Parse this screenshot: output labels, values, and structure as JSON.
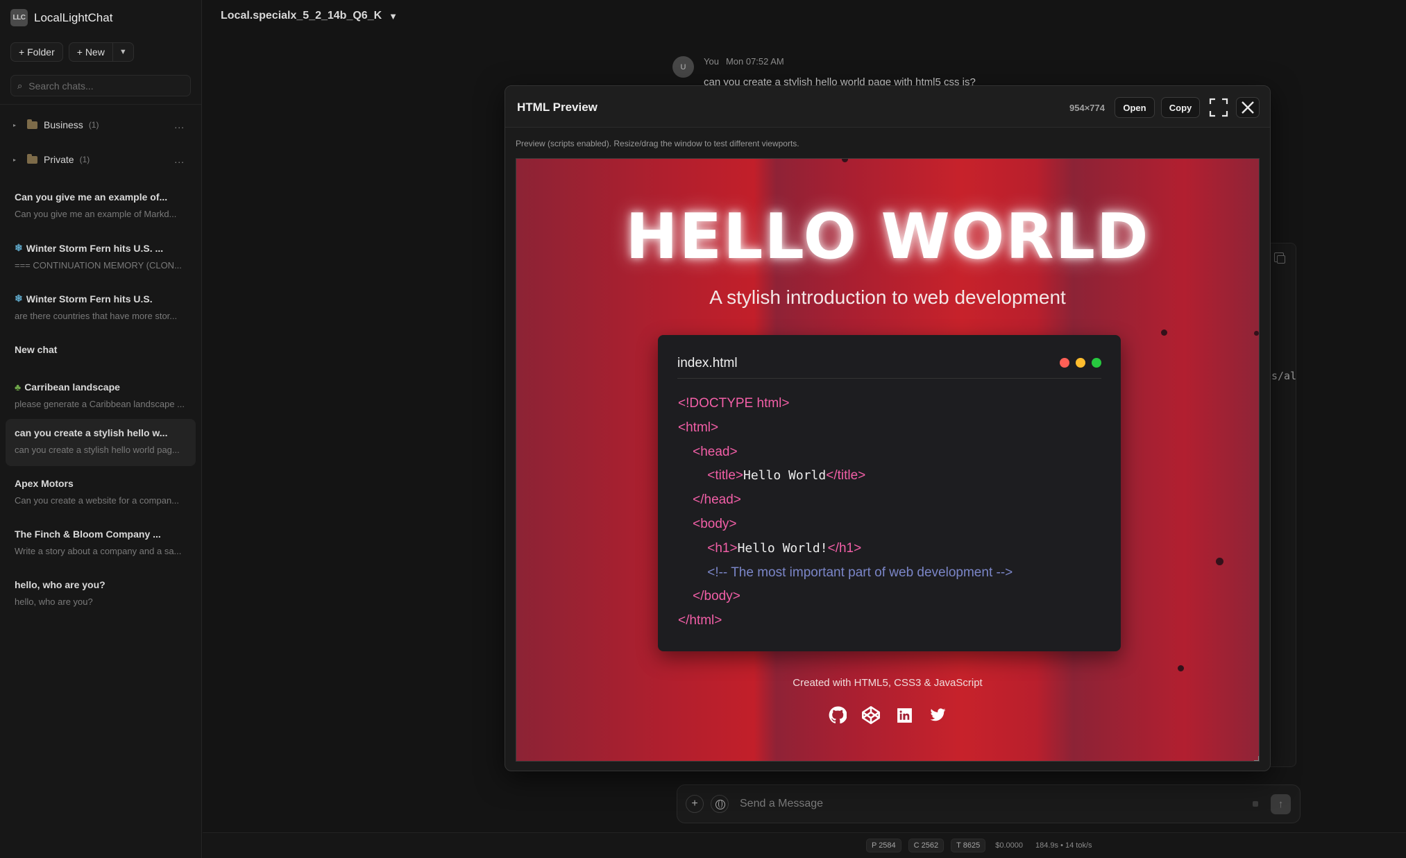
{
  "app": {
    "logo_text": "LLC",
    "name": "LocalLightChat"
  },
  "sidebar": {
    "folder_button": "+ Folder",
    "new_button": "+ New",
    "new_caret": "▼",
    "search_placeholder": "Search chats...",
    "folders": [
      {
        "name": "Business",
        "count": "(1)",
        "more": "..."
      },
      {
        "name": "Private",
        "count": "(1)",
        "more": "..."
      }
    ],
    "chats": [
      {
        "title": "Can you give me an example of...",
        "subtitle": "Can you give me an example of Markd...",
        "icon": ""
      },
      {
        "title": "Winter Storm Fern hits U.S. ...",
        "subtitle": "=== CONTINUATION MEMORY (CLON...",
        "icon": "snowflake-icon"
      },
      {
        "title": "Winter Storm Fern hits U.S.",
        "subtitle": "are there countries that have more stor...",
        "icon": "snowflake-icon"
      },
      {
        "title": "New chat",
        "subtitle": "",
        "icon": ""
      },
      {
        "title": "Carribean landscape",
        "subtitle": "please generate a Caribbean landscape ...",
        "icon": "palm-tree-icon"
      },
      {
        "title": "can you create a stylish hello w...",
        "subtitle": "can you create a stylish hello world pag...",
        "icon": "",
        "active": true
      },
      {
        "title": "Apex Motors",
        "subtitle": "Can you create a website for a compan...",
        "icon": ""
      },
      {
        "title": "The Finch & Bloom Company ...",
        "subtitle": "Write a story about a company and a sa...",
        "icon": ""
      },
      {
        "title": "hello, who are you?",
        "subtitle": "hello, who are you?",
        "icon": ""
      }
    ]
  },
  "header": {
    "model": "Local.specialx_5_2_14b_Q6_K",
    "model_caret": "▼"
  },
  "message": {
    "avatar": "U",
    "author": "You",
    "time": "Mon 07:52 AM",
    "text": "can you create a stylish hello world page with html5 css js?"
  },
  "background_code_fragment": "s/al",
  "preview": {
    "title": "HTML Preview",
    "size": "954×774",
    "open_label": "Open",
    "copy_label": "Copy",
    "note": "Preview (scripts enabled). Resize/drag the window to test different viewports.",
    "page": {
      "heading": "HELLO WORLD",
      "tagline": "A stylish introduction to web development",
      "code_title": "index.html",
      "code_lines": [
        {
          "indent": "",
          "tag": "<!DOCTYPE html>",
          "text": "",
          "close": ""
        },
        {
          "indent": "",
          "tag": "<html>",
          "text": "",
          "close": ""
        },
        {
          "indent": "    ",
          "tag": "<head>",
          "text": "",
          "close": ""
        },
        {
          "indent": "        ",
          "tag": "<title>",
          "text": "Hello World",
          "close": "</title>"
        },
        {
          "indent": "    ",
          "tag": "</head>",
          "text": "",
          "close": ""
        },
        {
          "indent": "    ",
          "tag": "<body>",
          "text": "",
          "close": ""
        },
        {
          "indent": "        ",
          "tag": "<h1>",
          "text": "Hello World!",
          "close": "</h1>"
        },
        {
          "indent": "        ",
          "comment": "<!-- The most important part of web development -->"
        },
        {
          "indent": "    ",
          "tag": "</body>",
          "text": "",
          "close": ""
        },
        {
          "indent": "",
          "tag": "</html>",
          "text": "",
          "close": ""
        }
      ],
      "footer": "Created with HTML5, CSS3 & JavaScript",
      "socials": [
        "github-icon",
        "codepen-icon",
        "linkedin-icon",
        "twitter-icon"
      ],
      "colors": {
        "dot_red": "#ff5f56",
        "dot_yellow": "#ffbd2e",
        "dot_green": "#27c93f",
        "tag_pink": "#f25fa7",
        "comment_blue": "#7b86c8"
      }
    }
  },
  "composer": {
    "placeholder": "Send a Message"
  },
  "status": {
    "prompt": "P 2584",
    "completion": "C 2562",
    "total": "T 8625",
    "cost": "$0.0000",
    "speed": "184.9s • 14 tok/s"
  }
}
